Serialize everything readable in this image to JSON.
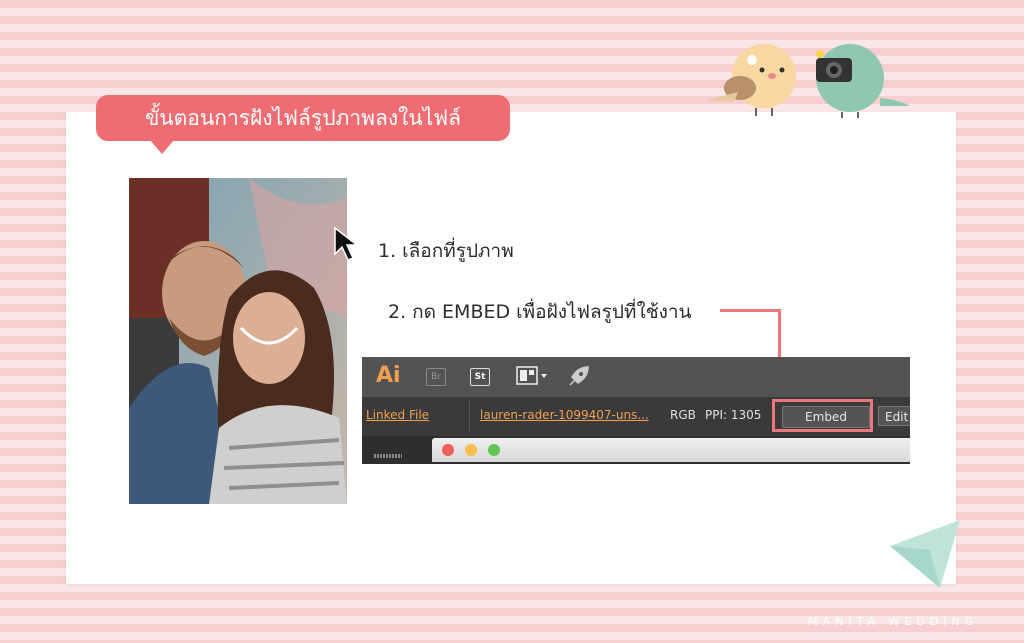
{
  "banner": {
    "title": "ขั้นตอนการฝังไฟล์รูปภาพลงในไฟล์"
  },
  "steps": {
    "step1": "1. เลือกที่รูปภาพ",
    "step2": "2. กด EMBED เพื่อฝังไฟลรูปที่ใช้งาน"
  },
  "app_toolbar": {
    "logo": "Ai",
    "bridge_label": "Br",
    "stock_label": "St"
  },
  "control_bar": {
    "linked_label": "Linked File",
    "file_name": "lauren-rader-1099407-uns...",
    "color_mode": "RGB",
    "ppi": "PPI: 1305",
    "embed_label": "Embed",
    "edit_label": "Edit"
  },
  "window_controls": {
    "close_color": "#ed5f57",
    "minimize_color": "#f5be4f",
    "maximize_color": "#62c655"
  },
  "watermark": "MANITA WEDDING",
  "colors": {
    "accent": "#ee6c72",
    "callout": "#e8787d",
    "ai_orange": "#f0a050"
  }
}
